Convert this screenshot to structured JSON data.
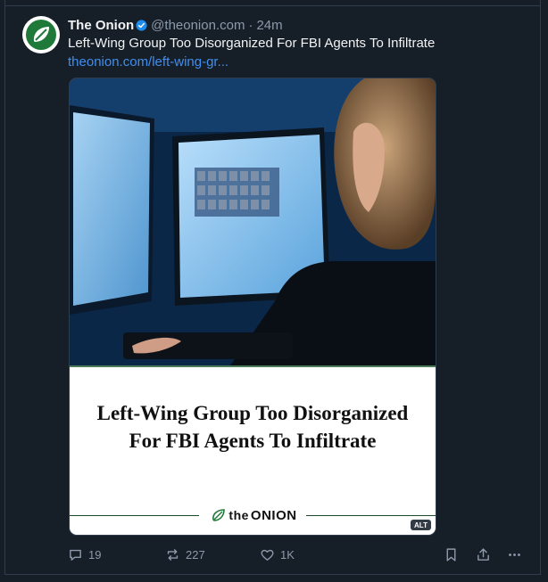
{
  "post": {
    "author_name": "The Onion",
    "author_handle": "@theonion.com",
    "separator": "·",
    "timestamp": "24m",
    "text": "Left-Wing Group Too Disorganized For FBI Agents To Infiltrate",
    "link_text": "theonion.com/left-wing-gr..."
  },
  "card": {
    "headline_line1": "Left-Wing Group Too Disorganized",
    "headline_line2": "For FBI Agents To Infiltrate",
    "brand_the": "the",
    "brand_onion": "ONION",
    "alt_badge": "ALT"
  },
  "actions": {
    "replies": "19",
    "reposts": "227",
    "likes": "1K"
  },
  "colors": {
    "background": "#161e27",
    "link": "#3f8ff2",
    "muted": "#8d9aab",
    "verified": "#1d8cf0",
    "onion_green": "#1f7a3a"
  }
}
